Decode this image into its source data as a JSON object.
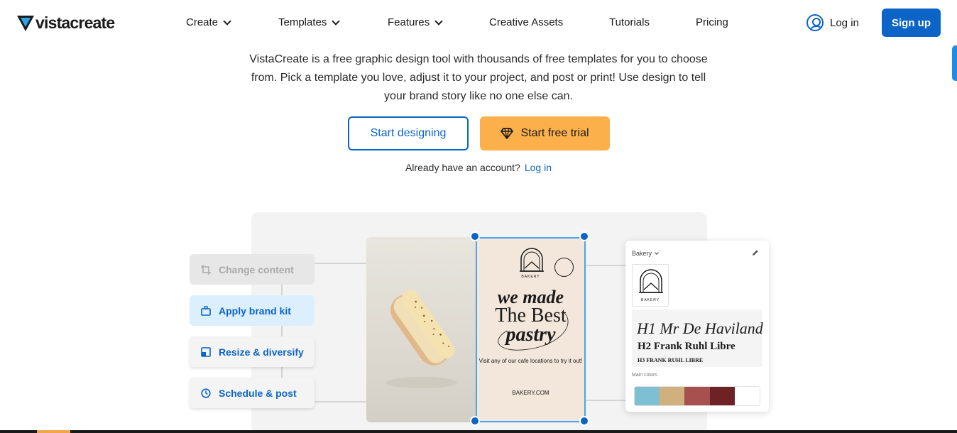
{
  "nav": {
    "logo": "vistacreate",
    "items": [
      {
        "label": "Create",
        "dropdown": true
      },
      {
        "label": "Templates",
        "dropdown": true
      },
      {
        "label": "Features",
        "dropdown": true
      },
      {
        "label": "Creative Assets",
        "dropdown": false
      },
      {
        "label": "Tutorials",
        "dropdown": false
      },
      {
        "label": "Pricing",
        "dropdown": false
      }
    ],
    "login": "Log in",
    "signup": "Sign up"
  },
  "hero": {
    "description": "VistaCreate is a free graphic design tool with thousands of free templates for you to choose from. Pick a template you love, adjust it to your project, and post or print! Use design to tell your brand story like no one else can.",
    "start_designing": "Start designing",
    "start_trial": "Start free trial",
    "already_text": "Already have an account?",
    "login_link": "Log in"
  },
  "features": [
    {
      "label": "Change content",
      "icon": "crop-icon",
      "state": "disabled"
    },
    {
      "label": "Apply brand kit",
      "icon": "briefcase-icon",
      "state": "active"
    },
    {
      "label": "Resize & diversify",
      "icon": "resize-icon",
      "state": "default"
    },
    {
      "label": "Schedule & post",
      "icon": "clock-icon",
      "state": "default"
    }
  ],
  "poster": {
    "brand": "BAKERY",
    "title_line1": "we made",
    "title_line2": "The Best",
    "title_line3": "pastry",
    "subtitle": "Visit any of our cafe locations to try it out!",
    "url": "BAKERY.COM"
  },
  "brand_kit": {
    "name": "Bakery",
    "logo_text": "BAKERY",
    "h1": "H1 Mr De Haviland",
    "h2": "H2 Frank Ruhl Libre",
    "h3": "H3 FRANK RUHL LIBRE",
    "colors_label": "Main colors",
    "colors": [
      "#7fbfd4",
      "#d0b07d",
      "#a6504f",
      "#6e2226",
      "#ffffff"
    ]
  },
  "theme": {
    "primary": "#0b64c6",
    "trial_orange": "#fbb04c",
    "active_feature_bg": "#dcefff"
  }
}
